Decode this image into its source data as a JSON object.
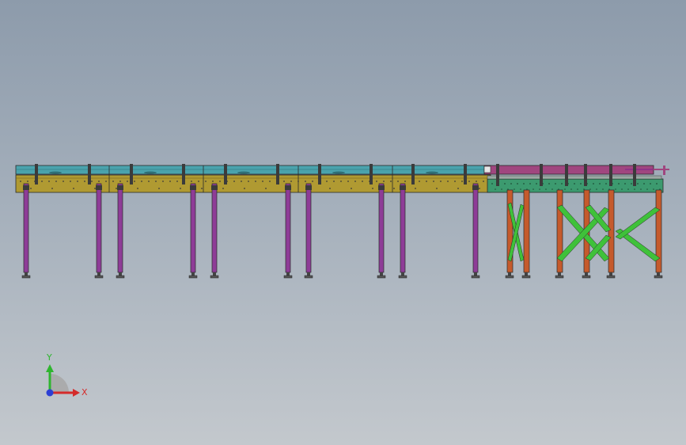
{
  "viewport": {
    "background_top": "#8d9bab",
    "background_bottom": "#c3c8cd"
  },
  "model": {
    "colors": {
      "top_rail": "#4aa3ad",
      "bed_rail": "#b09a32",
      "leg_purple": "#8e3c97",
      "rail_pink": "#a0467f",
      "bed_green": "#3c9a6f",
      "leg_orange": "#c55a2c",
      "brace_green": "#3fc13a",
      "outline": "#2a2a2a"
    }
  },
  "triad": {
    "x_label": "X",
    "y_label": "Y",
    "x_color": "#d42b2b",
    "y_color": "#2fb52f",
    "z_color": "#2c3fd4"
  }
}
